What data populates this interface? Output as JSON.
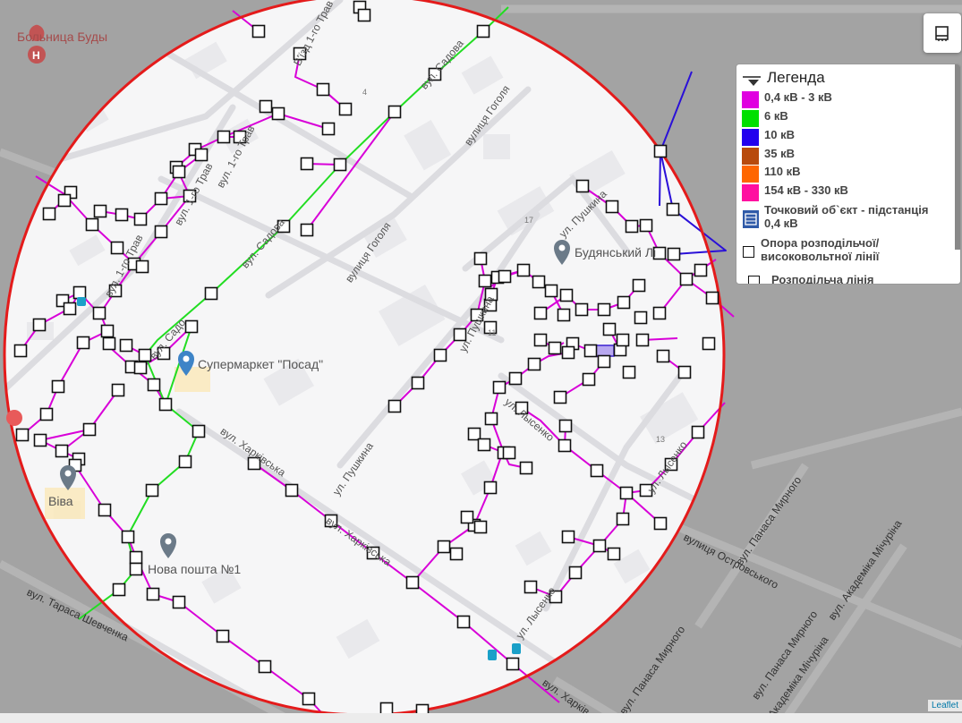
{
  "map": {
    "labels": {
      "hospital": "Больница Буды",
      "supermarket": "Супермаркет \"Посад\"",
      "viva": "Віва",
      "nova_poshta": "Нова пошта №1",
      "budyansky": "Будянський Лі",
      "vyizd1": "В'їзд 1-го Трав",
      "vul1trav_a": "вул. 1-го Трав",
      "vul1trav_b": "вул. 1-го Трав",
      "vul1trav_c": "вул. 1-го Трав",
      "vul_sadova": "вул. Садова",
      "vul_sadova_b": "вул. Садова",
      "vul_sadova_c": "вул. Садо",
      "vulytsia_hoholia": "вулиця Гоголя",
      "vulytsia_hoholia_b": "вулиця Гоголя",
      "ul_pushkina_a": "ул. Пушкина",
      "ul_pushkina_b": "ул. Пушкина",
      "ul_pushkina_c": "ул. Пушкина",
      "vul_kharkivska_a": "вул. Харківська",
      "vul_kharkivska_b": "вул. Харківська",
      "vul_kharkivska_c": "вул. Харків",
      "ul_lysenko_a": "ул. Лысенко",
      "ul_lysenko_b": "ул. Лысенко",
      "ul_lysenko_c": "ул. Лысенко",
      "vul_tarasa": "вул. Тараса Шевченка",
      "vul_ostrovskoho": "вулиця Островського",
      "vul_panasa_a": "вул. Панаса Мирного",
      "vul_panasa_b": "вул. Панаса Мирного",
      "vul_panasa_c": "вул. Панаса Мирного",
      "vul_akademika_a": "вул. Академіка Мічуріна",
      "vul_akademika_b": "вул. Академіка Мічуріна",
      "num4": "4",
      "num17": "17",
      "num13": "13",
      "num11": "11"
    },
    "attribution": "Leaflet"
  },
  "legend": {
    "title": "Легенда",
    "items": [
      {
        "label": "0,4 кВ - 3 кВ",
        "color": "#e000e0"
      },
      {
        "label": "6 кВ",
        "color": "#00e000"
      },
      {
        "label": "10 кВ",
        "color": "#2200ee"
      },
      {
        "label": "35 кВ",
        "color": "#b84a0c"
      },
      {
        "label": "110 кВ",
        "color": "#ff6600"
      },
      {
        "label": "154 кВ - 330 кВ",
        "color": "#ff10a0"
      }
    ],
    "substation": "Точковий об`єкт - підстанція 0,4 кВ",
    "pole": "Опора розподільчої/ високовольтної лінії",
    "line": "Розподільча лінія"
  },
  "colors": {
    "low": "#d800d8",
    "six": "#22dd22",
    "ten": "#2a10d8",
    "circle": "#e41b1b"
  }
}
